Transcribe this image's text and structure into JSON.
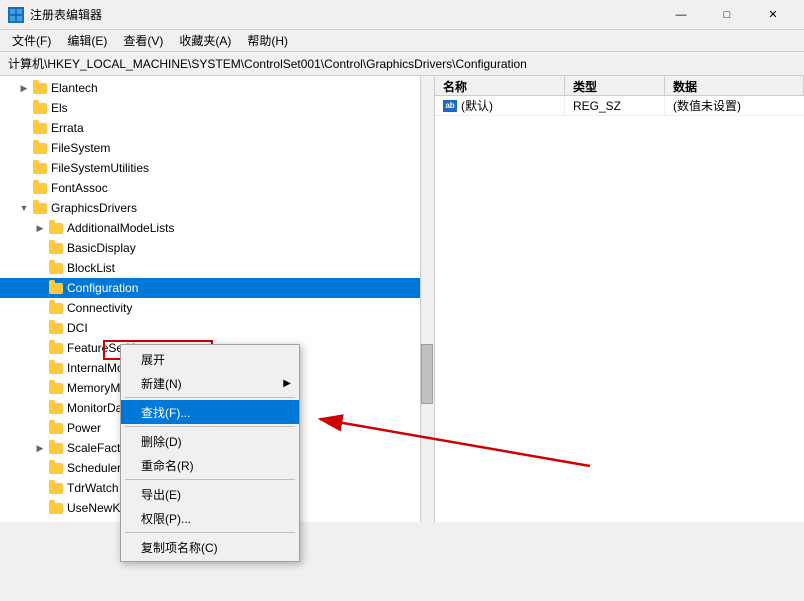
{
  "titleBar": {
    "icon": "🗄",
    "title": "注册表编辑器",
    "minimizeLabel": "—",
    "maximizeLabel": "□",
    "closeLabel": "✕"
  },
  "menuBar": {
    "items": [
      "文件(F)",
      "编辑(E)",
      "查看(V)",
      "收藏夹(A)",
      "帮助(H)"
    ]
  },
  "addressBar": {
    "path": "计算机\\HKEY_LOCAL_MACHINE\\SYSTEM\\ControlSet001\\Control\\GraphicsDrivers\\Configuration"
  },
  "columns": {
    "name": "名称",
    "type": "类型",
    "data": "数据"
  },
  "registryEntries": [
    {
      "name": "(默认)",
      "namePrefix": "ab",
      "type": "REG_SZ",
      "data": "(数值未设置)"
    }
  ],
  "treeItems": [
    {
      "level": 1,
      "text": "Elantech",
      "hasExpander": true,
      "expanded": false
    },
    {
      "level": 1,
      "text": "Els",
      "hasExpander": false,
      "expanded": false
    },
    {
      "level": 1,
      "text": "Errata",
      "hasExpander": false,
      "expanded": false
    },
    {
      "level": 1,
      "text": "FileSystem",
      "hasExpander": false,
      "expanded": false
    },
    {
      "level": 1,
      "text": "FileSystemUtilities",
      "hasExpander": false,
      "expanded": false
    },
    {
      "level": 1,
      "text": "FontAssoc",
      "hasExpander": false,
      "expanded": false
    },
    {
      "level": 1,
      "text": "GraphicsDrivers",
      "hasExpander": true,
      "expanded": true
    },
    {
      "level": 2,
      "text": "AdditionalModeLists",
      "hasExpander": true,
      "expanded": false
    },
    {
      "level": 2,
      "text": "BasicDisplay",
      "hasExpander": false,
      "expanded": false
    },
    {
      "level": 2,
      "text": "BlockList",
      "hasExpander": false,
      "expanded": false
    },
    {
      "level": 2,
      "text": "Configuration",
      "hasExpander": false,
      "expanded": false,
      "selected": true
    },
    {
      "level": 2,
      "text": "Connectivity",
      "hasExpander": false,
      "expanded": false
    },
    {
      "level": 2,
      "text": "DCI",
      "hasExpander": false,
      "expanded": false
    },
    {
      "level": 2,
      "text": "FeatureSetUs...",
      "hasExpander": false,
      "expanded": false
    },
    {
      "level": 2,
      "text": "InternalMon...",
      "hasExpander": false,
      "expanded": false
    },
    {
      "level": 2,
      "text": "MemoryMan...",
      "hasExpander": false,
      "expanded": false
    },
    {
      "level": 2,
      "text": "MonitorData",
      "hasExpander": false,
      "expanded": false
    },
    {
      "level": 2,
      "text": "Power",
      "hasExpander": false,
      "expanded": false
    },
    {
      "level": 2,
      "text": "ScaleFactors",
      "hasExpander": true,
      "expanded": false
    },
    {
      "level": 2,
      "text": "Scheduler",
      "hasExpander": false,
      "expanded": false
    },
    {
      "level": 2,
      "text": "TdrWatch",
      "hasExpander": false,
      "expanded": false
    },
    {
      "level": 2,
      "text": "UseNewKey",
      "hasExpander": false,
      "expanded": false
    }
  ],
  "contextMenu": {
    "items": [
      {
        "label": "展开",
        "type": "item"
      },
      {
        "label": "新建(N)",
        "type": "item",
        "hasArrow": true
      },
      {
        "type": "separator"
      },
      {
        "label": "查找(F)...",
        "type": "item",
        "highlighted": true
      },
      {
        "type": "separator"
      },
      {
        "label": "删除(D)",
        "type": "item"
      },
      {
        "label": "重命名(R)",
        "type": "item"
      },
      {
        "type": "separator"
      },
      {
        "label": "导出(E)",
        "type": "item"
      },
      {
        "label": "权限(P)...",
        "type": "item"
      },
      {
        "type": "separator"
      },
      {
        "label": "复制项名称(C)",
        "type": "item"
      }
    ]
  }
}
